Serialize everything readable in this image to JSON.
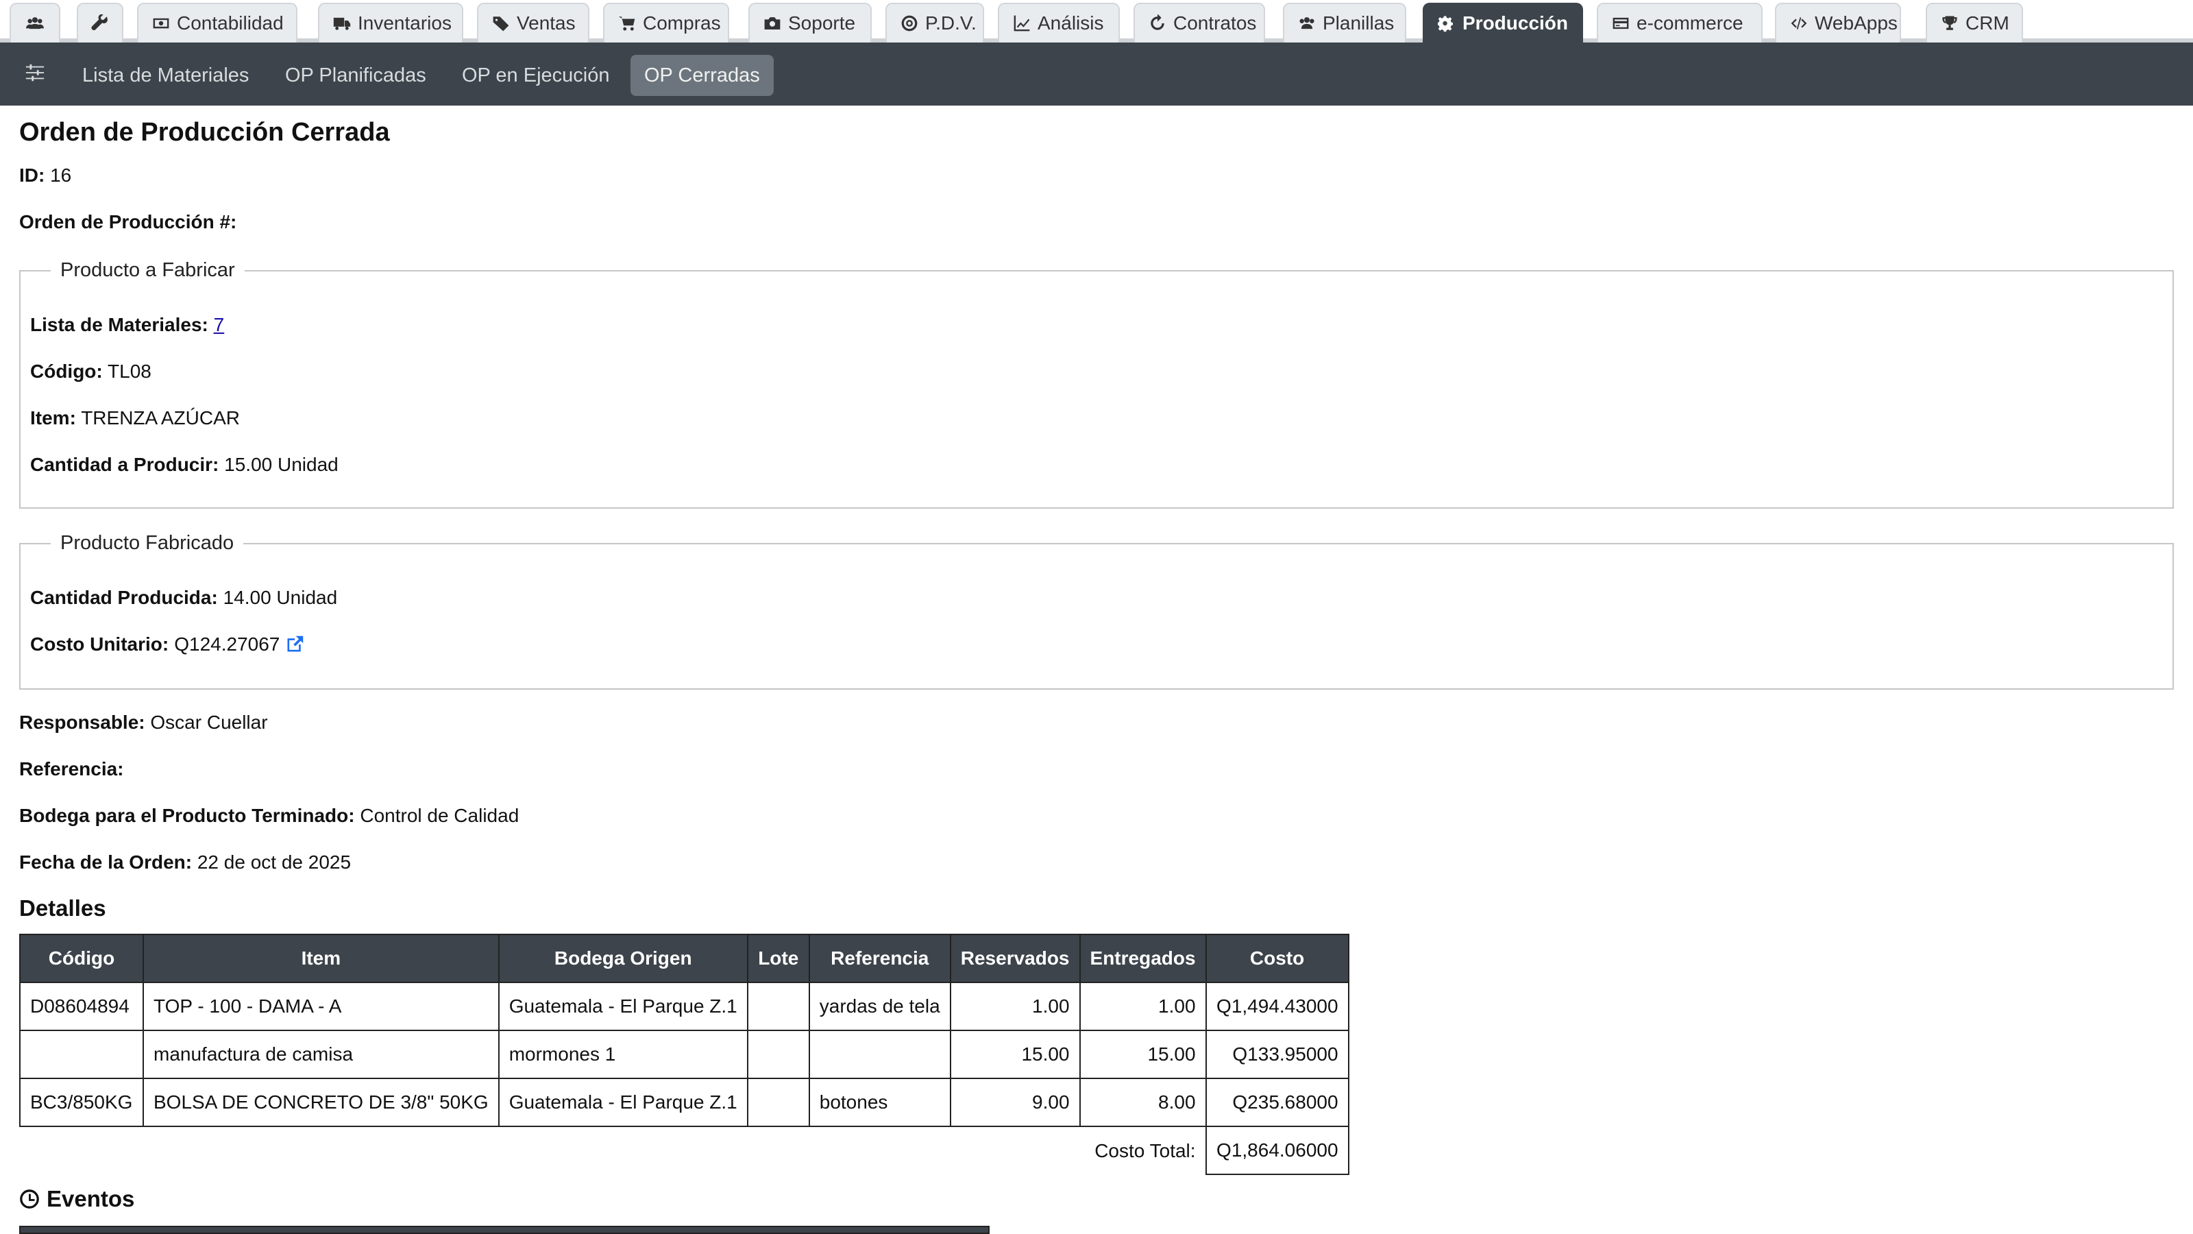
{
  "top_tabs": [
    {
      "label": "",
      "icon": "users-icon"
    },
    {
      "label": "",
      "icon": "wrench-icon"
    },
    {
      "label": "Contabilidad",
      "icon": "money-icon"
    },
    {
      "label": "Inventarios",
      "icon": "truck-icon"
    },
    {
      "label": "Ventas",
      "icon": "tags-icon"
    },
    {
      "label": "Compras",
      "icon": "cart-icon"
    },
    {
      "label": "Soporte",
      "icon": "camera-icon"
    },
    {
      "label": "P.D.V.",
      "icon": "target-icon"
    },
    {
      "label": "Análisis",
      "icon": "line-chart-icon"
    },
    {
      "label": "Contratos",
      "icon": "refresh-icon"
    },
    {
      "label": "Planillas",
      "icon": "users-icon"
    },
    {
      "label": "Producción",
      "icon": "gears-icon",
      "active": true
    },
    {
      "label": "e-commerce",
      "icon": "credit-card-icon"
    },
    {
      "label": "WebApps",
      "icon": "code-icon"
    },
    {
      "label": "CRM",
      "icon": "trophy-icon"
    }
  ],
  "subnav": {
    "items": [
      "Lista de Materiales",
      "OP Planificadas",
      "OP en Ejecución",
      "OP Cerradas"
    ],
    "active": "OP Cerradas"
  },
  "page": {
    "title": "Orden de Producción Cerrada",
    "id_label": "ID:",
    "id_value": "16",
    "order_label": "Orden de Producción #:",
    "order_value": ""
  },
  "producto_a_fabricar": {
    "legend": "Producto a Fabricar",
    "bom_label": "Lista de Materiales:",
    "bom_value": "7",
    "code_label": "Código:",
    "code_value": "TL08",
    "item_label": "Item:",
    "item_value": "TRENZA AZÚCAR",
    "qty_label": "Cantidad a Producir:",
    "qty_value": "15.00 Unidad"
  },
  "producto_fabricado": {
    "legend": "Producto Fabricado",
    "produced_label": "Cantidad Producida:",
    "produced_value": "14.00 Unidad",
    "unit_cost_label": "Costo Unitario:",
    "unit_cost_value": "Q124.27067"
  },
  "info": {
    "responsable_label": "Responsable:",
    "responsable_value": "Oscar Cuellar",
    "referencia_label": "Referencia:",
    "referencia_value": "",
    "bodega_label": "Bodega para el Producto Terminado:",
    "bodega_value": "Control de Calidad",
    "fecha_label": "Fecha de la Orden:",
    "fecha_value": "22 de oct de 2025"
  },
  "detalles": {
    "heading": "Detalles",
    "columns": [
      "Código",
      "Item",
      "Bodega Origen",
      "Lote",
      "Referencia",
      "Reservados",
      "Entregados",
      "Costo"
    ],
    "rows": [
      [
        "D08604894",
        "TOP - 100 - DAMA - A",
        "Guatemala - El Parque Z.1",
        "",
        "yardas de tela",
        "1.00",
        "1.00",
        "Q1,494.43000"
      ],
      [
        "",
        "manufactura de camisa",
        "mormones 1",
        "",
        "",
        "15.00",
        "15.00",
        "Q133.95000"
      ],
      [
        "BC3/850KG",
        "BOLSA DE CONCRETO DE 3/8\" 50KG",
        "Guatemala - El Parque Z.1",
        "",
        "botones",
        "9.00",
        "8.00",
        "Q235.68000"
      ]
    ],
    "total_label": "Costo Total:",
    "total_value": "Q1,864.06000"
  },
  "eventos": {
    "heading": "Eventos",
    "icon": "clock-icon"
  },
  "colors": {
    "dark_bar": "#3d444b",
    "active_sub": "#6c757d",
    "link": "#1a0dab"
  }
}
